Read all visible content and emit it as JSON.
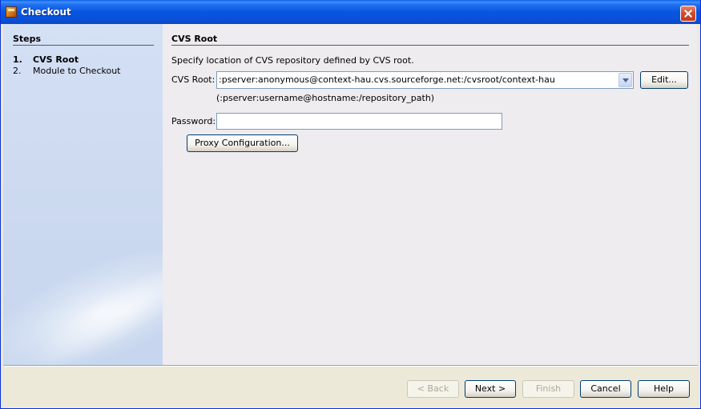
{
  "window": {
    "title": "Checkout",
    "close_label": "×"
  },
  "steps": {
    "title": "Steps",
    "items": [
      {
        "number": "1.",
        "label": "CVS Root",
        "current": true
      },
      {
        "number": "2.",
        "label": "Module to Checkout",
        "current": false
      }
    ]
  },
  "main": {
    "section_title": "CVS Root",
    "description": "Specify location of CVS repository defined by CVS root.",
    "cvs_root_label": "CVS Root:",
    "cvs_root_value": ":pserver:anonymous@context-hau.cvs.sourceforge.net:/cvsroot/context-hau",
    "edit_button": "Edit...",
    "hint": "(:pserver:username@hostname:/repository_path)",
    "password_label": "Password:",
    "password_value": "",
    "proxy_button": "Proxy Configuration..."
  },
  "footer": {
    "back": "< Back",
    "next": "Next >",
    "finish": "Finish",
    "cancel": "Cancel",
    "help": "Help"
  },
  "colors": {
    "titlebar": "#0a50d8",
    "steps_panel": "#cddaf0",
    "content_bg": "#eeecee"
  }
}
